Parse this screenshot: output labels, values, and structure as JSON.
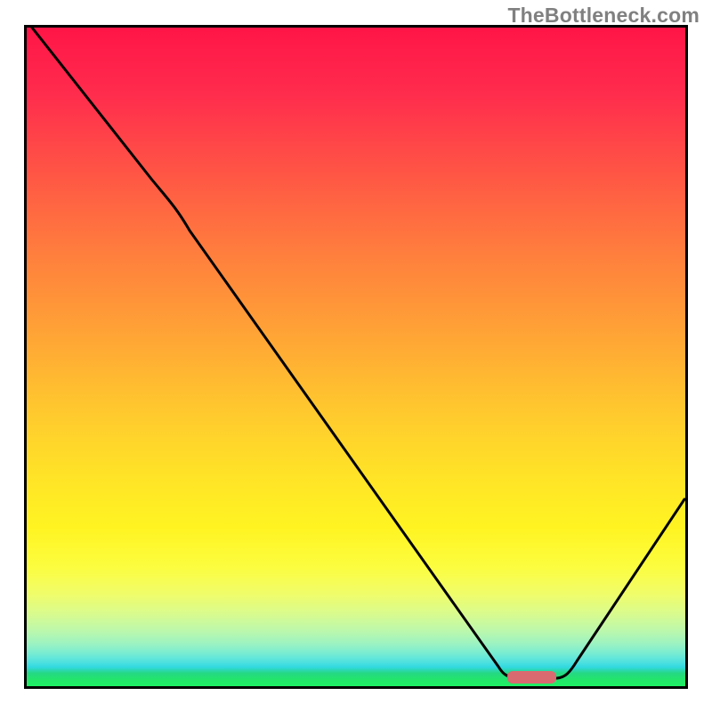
{
  "watermark": "TheBottleneck.com",
  "colors": {
    "border": "#000000",
    "marker": "#d96a70",
    "watermark": "#808080",
    "gradient_top": "#ff1547",
    "gradient_bottom": "#1ef064"
  },
  "chart_data": {
    "type": "line",
    "title": "",
    "xlabel": "",
    "ylabel": "",
    "xlim": [
      0,
      100
    ],
    "ylim": [
      0,
      100
    ],
    "series": [
      {
        "name": "bottleneck-curve",
        "x": [
          0,
          10,
          19,
          24,
          36,
          48,
          60,
          70,
          74,
          78,
          80,
          88,
          100
        ],
        "values": [
          100,
          88,
          77,
          70,
          52,
          35,
          18,
          5,
          2,
          1,
          1,
          12,
          28
        ]
      }
    ],
    "annotations": [
      {
        "name": "optimal-marker",
        "x_start": 73,
        "x_end": 80,
        "y": 1
      }
    ]
  }
}
